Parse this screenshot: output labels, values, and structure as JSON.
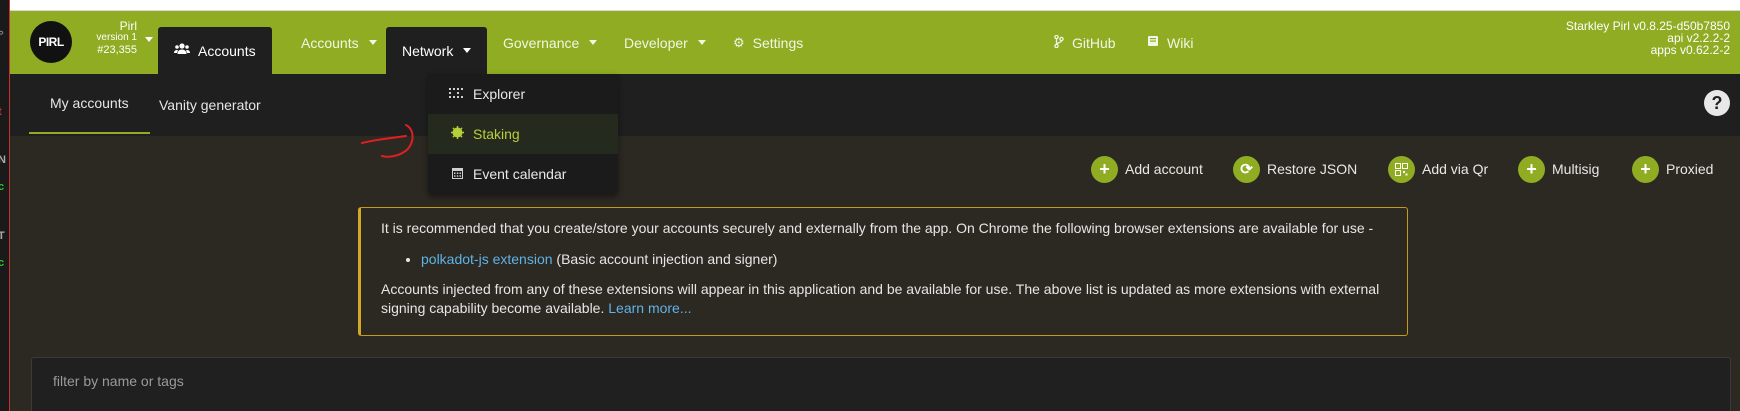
{
  "colors": {
    "brand": "#8fac23",
    "header_bg": "#8fac23",
    "dark_bg": "#1f1f1f",
    "content_bg": "#2c2822",
    "warning_border": "#c49a1a",
    "link": "#5fb3e6",
    "staking_highlight": "#b6d03a",
    "annotation": "#e02020"
  },
  "chain": {
    "logo_text": "PIRL",
    "name": "Pirl",
    "version": "version 1",
    "block": "#23,355"
  },
  "nav": {
    "accounts_tab": "Accounts",
    "items": [
      {
        "label": "Accounts"
      },
      {
        "label": "Network"
      },
      {
        "label": "Governance"
      },
      {
        "label": "Developer"
      },
      {
        "label": "Settings"
      }
    ],
    "github": "GitHub",
    "wiki": "Wiki"
  },
  "node_info": {
    "line1": "Starkley Pirl v0.8.25-d50b7850",
    "line2": "api v2.2.2-2",
    "line3": "apps v0.62.2-2"
  },
  "dropdown": {
    "items": [
      {
        "label": "Explorer",
        "icon": "grid-icon"
      },
      {
        "label": "Staking",
        "icon": "certificate-icon"
      },
      {
        "label": "Event calendar",
        "icon": "calendar-icon"
      }
    ]
  },
  "subnav": {
    "tabs": [
      {
        "label": "My accounts"
      },
      {
        "label": "Vanity generator"
      }
    ]
  },
  "actions": [
    {
      "label": "Add account",
      "icon": "plus-icon"
    },
    {
      "label": "Restore JSON",
      "icon": "sync-icon"
    },
    {
      "label": "Add via Qr",
      "icon": "qrcode-icon"
    },
    {
      "label": "Multisig",
      "icon": "plus-icon"
    },
    {
      "label": "Proxied",
      "icon": "plus-icon"
    }
  ],
  "notice": {
    "line1": "It is recommended that you create/store your accounts securely and externally from the app. On Chrome the following browser extensions are available for use -",
    "ext_link": "polkadot-js extension",
    "ext_desc": " (Basic account injection and signer)",
    "line2": "Accounts injected from any of these extensions will appear in this application and be available for use. The above list is updated as more extensions with external signing capability become available. ",
    "learn_more": "Learn more..."
  },
  "filter": {
    "placeholder": "filter by name or tags"
  }
}
